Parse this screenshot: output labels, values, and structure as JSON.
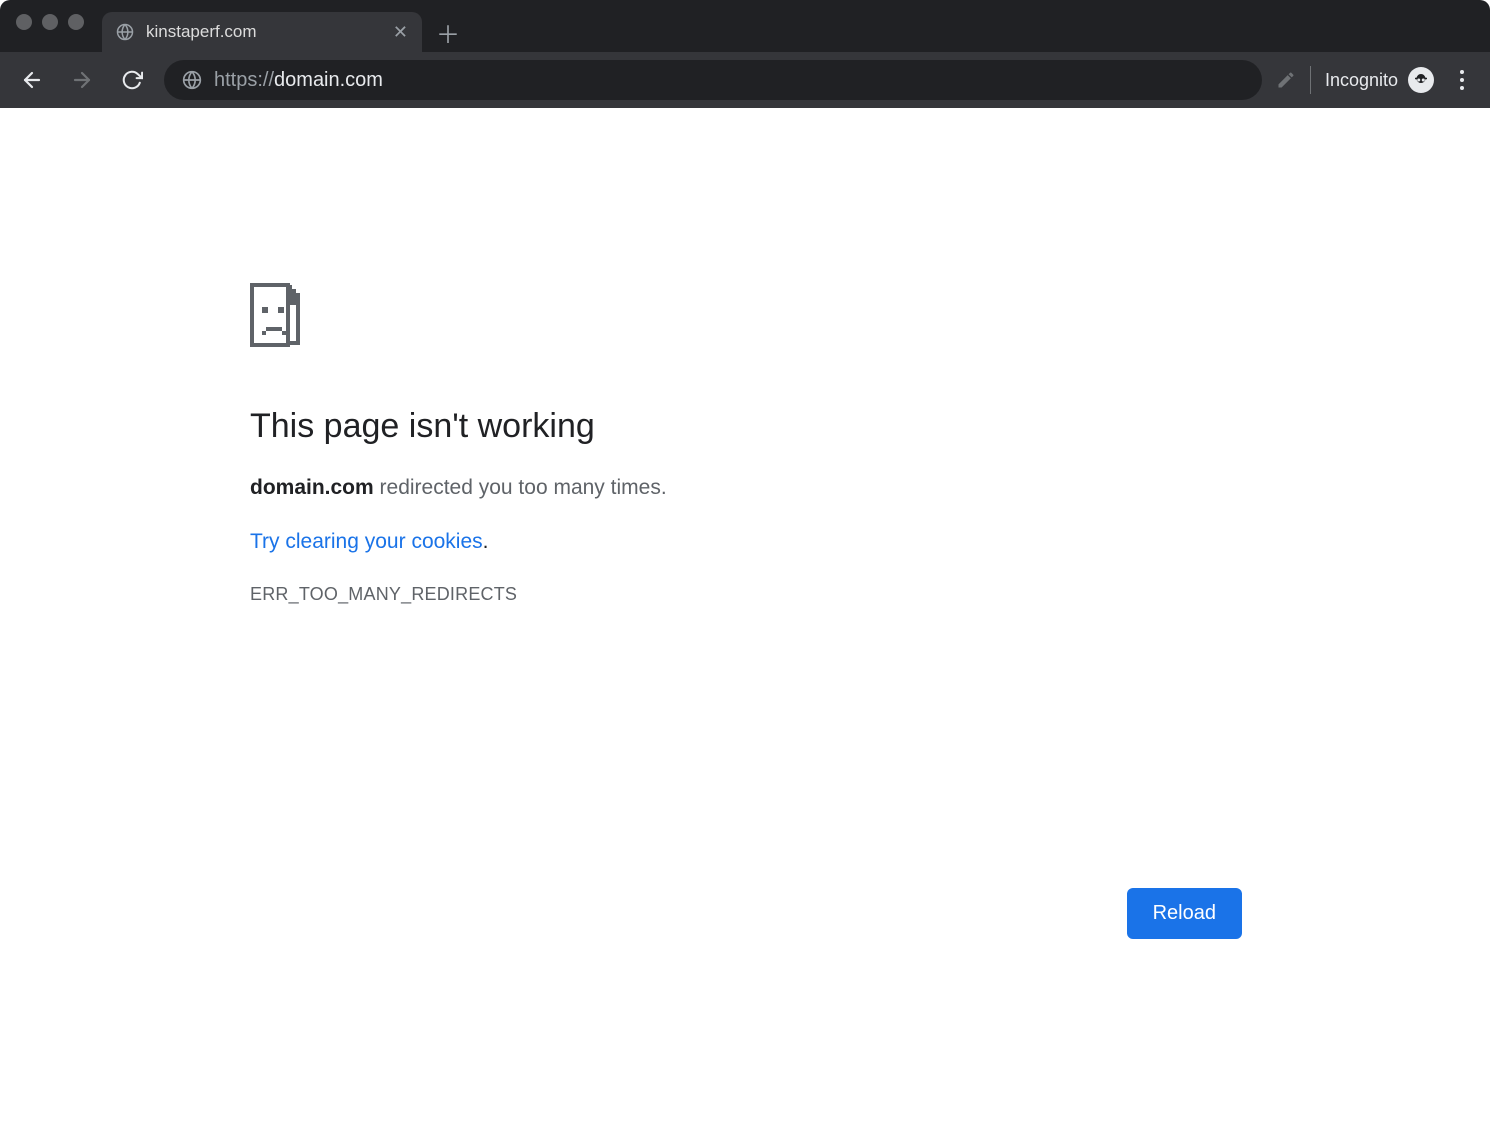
{
  "tab": {
    "title": "kinstaperf.com"
  },
  "addressbar": {
    "scheme": "https://",
    "host": "domain.com"
  },
  "toolbar": {
    "incognito_label": "Incognito"
  },
  "error": {
    "title": "This page isn't working",
    "domain": "domain.com",
    "message_suffix": " redirected you too many times.",
    "link_text": "Try clearing your cookies",
    "link_period": ".",
    "code": "ERR_TOO_MANY_REDIRECTS",
    "reload_label": "Reload"
  }
}
